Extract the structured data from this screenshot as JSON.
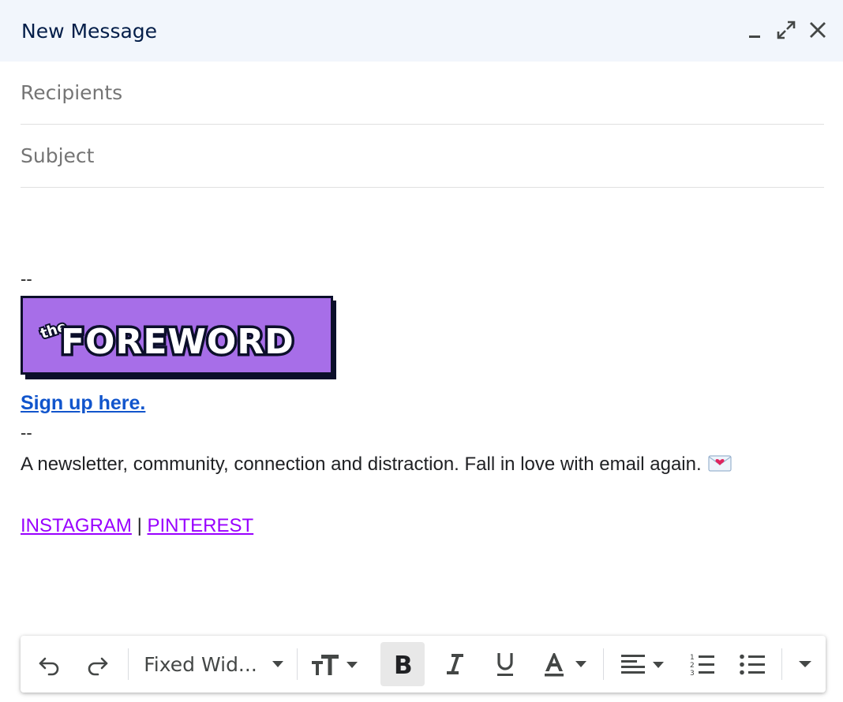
{
  "window": {
    "title": "New Message",
    "icons": [
      "minimize-icon",
      "expand-icon",
      "close-icon"
    ]
  },
  "fields": {
    "recipients_placeholder": "Recipients",
    "recipients_value": "",
    "subject_placeholder": "Subject",
    "subject_value": ""
  },
  "body": {
    "dash_top": "--",
    "logo_alt": "the FOREWORD",
    "signup_link": "Sign up here.",
    "dash_bottom": "--",
    "tagline": "A newsletter, community, connection and distraction. Fall in love with email again.",
    "social": {
      "instagram": "INSTAGRAM",
      "separator": "|",
      "pinterest": "PINTEREST"
    }
  },
  "toolbar": {
    "font_family": "Fixed Wid...",
    "bold_active": true,
    "icons": [
      "undo-icon",
      "redo-icon",
      "font-size-icon",
      "bold-icon",
      "italic-icon",
      "underline-icon",
      "text-color-icon",
      "align-icon",
      "numbered-list-icon",
      "bulleted-list-icon",
      "more-options-icon"
    ]
  },
  "colors": {
    "header_bg": "#f2f6fc",
    "title": "#041e49",
    "link": "#1155cc",
    "social_link": "#9900ff",
    "logo_bg": "#a76ee8",
    "logo_border": "#0b0f2a"
  }
}
